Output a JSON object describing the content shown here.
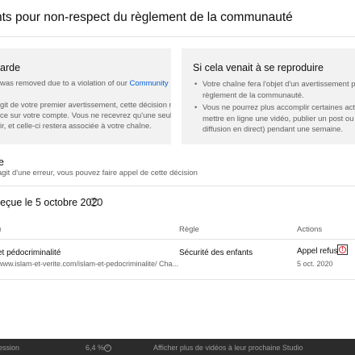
{
  "dialog": {
    "title": "nts pour non-respect du règlement de la communauté"
  },
  "card_left": {
    "title": "arde",
    "line1_prefix": "was removed due to a violation of our ",
    "line1_link": "Community",
    "line2": "git de votre premier avertissement, cette décision n'a",
    "line3": "ce sur votre compte. Vous ne recevrez qu'une seule",
    "line4": "ir, et celle-ci restera associée à votre chaîne."
  },
  "card_right": {
    "title": "Si cela venait à se reproduire",
    "bullets": [
      {
        "l1": "Votre chaîne fera l'objet d'un avertissement pour n",
        "l2": "règlement de la communauté."
      },
      {
        "l1": "Vous ne pourrez plus accomplir certaines actions p",
        "l2": "mettre en ligne une vidéo, publier un post ou effect",
        "l3": "diffusion en direct) pendant une semaine."
      }
    ]
  },
  "appeal": {
    "heading": "e",
    "text": "agit d'une erreur, vous pouvez faire appel de cette décision"
  },
  "received": {
    "label": "reçue le 5 octobre 2020",
    "info_icon": "info-icon"
  },
  "table": {
    "headers": [
      "u",
      "Règle",
      "Actions"
    ],
    "rows": [
      {
        "title": "et pédocriminalité",
        "url": "www.islam-et-verite.com/islam-et-pedocriminalite/ Cha...",
        "rule": "Sécurité des enfants",
        "status": "Appel refusé",
        "date": "5 oct. 2020",
        "status_icon": "error-circle-icon"
      }
    ]
  },
  "bottom_bar": {
    "left": "ession",
    "percent": "6,4 %",
    "right": "Afficher plus de vidéos à leur prochaine Studio"
  },
  "colors": {
    "link": "#065fd4",
    "error": "#d61f26",
    "card_bg": "#f2f2f2"
  }
}
